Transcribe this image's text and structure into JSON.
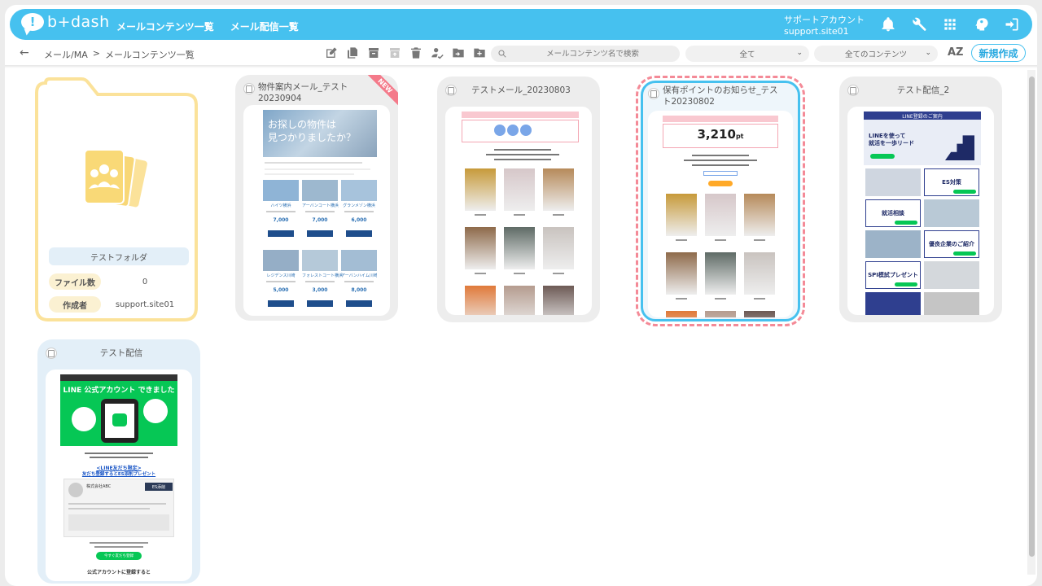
{
  "app": {
    "logo_text": "b+dash"
  },
  "topnav": [
    "メールコンテンツ一覧",
    "メール配信一覧"
  ],
  "account": {
    "name": "サポートアカウント",
    "site": "support.site01"
  },
  "top_icons": [
    "bell-icon",
    "wrench-icon",
    "grid-icon",
    "brain-icon",
    "logout-icon"
  ],
  "breadcrumb": {
    "root": "メール/MA",
    "sep": ">",
    "current": "メールコンテンツ一覧"
  },
  "toolbar_icons": [
    "edit-icon",
    "copy-icon",
    "archive-icon",
    "unarchive-icon",
    "trash-icon",
    "user-check-icon",
    "move-folder-icon",
    "add-folder-icon"
  ],
  "search": {
    "placeholder": "メールコンテンツ名で検索"
  },
  "filters": {
    "status": "全て",
    "type": "全てのコンテンツ"
  },
  "sort_label": "AZ",
  "new_button": "新規作成",
  "folder": {
    "name": "テストフォルダ",
    "file_count_label": "ファイル数",
    "file_count": "0",
    "creator_label": "作成者",
    "creator": "support.site01"
  },
  "cards": [
    {
      "title": "物件案内メール_テスト20230904",
      "badge": "NEW",
      "state": "new"
    },
    {
      "title": "テストメール_20230803",
      "state": "normal"
    },
    {
      "title": "保有ポイントのお知らせ_テスト20230802",
      "state": "selected"
    },
    {
      "title": "テスト配信_2",
      "state": "normal"
    },
    {
      "title": "テスト配信",
      "state": "highlight"
    }
  ],
  "thumbs": {
    "property": {
      "hero": "お探しの物件は\n見つかりましたか？",
      "names": [
        "ハイツ横浜",
        "アーバンコート横浜",
        "グランメゾン横浜",
        "レジデンス川崎",
        "フォレストコート横浜",
        "アーバンハイム川崎"
      ],
      "prices": [
        "7,000",
        "7,000",
        "6,000",
        "5,000",
        "3,000",
        "8,000"
      ]
    },
    "point": {
      "value": "3,210",
      "unit": "pt"
    },
    "line_recruit": {
      "title": "LINE登録のご案内",
      "sub": "LINEを使って\n就活を一歩リード",
      "tiles": [
        "ES対策",
        "就活相談",
        "優良企業のご紹介",
        "SPI模試プレゼント"
      ]
    },
    "line_official": {
      "top": "LINE 公式アカウント できました",
      "promo1": "<LINE友だち限定>",
      "promo2": "友だち登録するとES添削プレゼント",
      "company": "株式会社ABC",
      "tag": "ES添削",
      "cta": "今すぐ友だち登録",
      "footer": "公式アカウントに登録すると"
    }
  }
}
